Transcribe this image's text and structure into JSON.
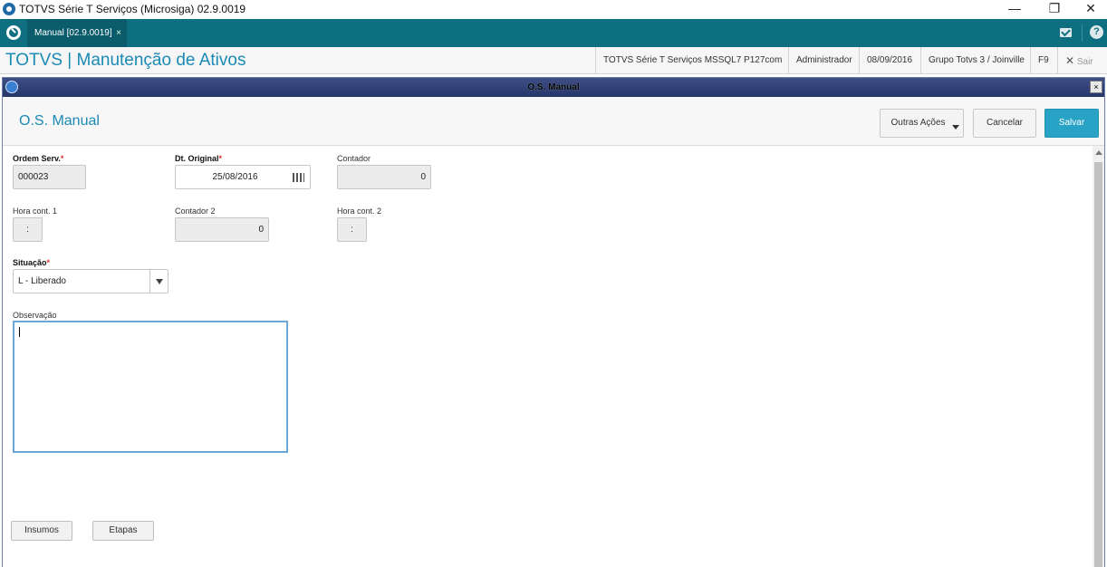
{
  "window": {
    "title": "TOTVS Série T Serviços (Microsiga) 02.9.0019",
    "minimize": "—",
    "restore": "❐",
    "close": "✕"
  },
  "tabbar": {
    "tab_label": "Manual [02.9.0019]",
    "tab_close": "×",
    "help": "?"
  },
  "header": {
    "title": "TOTVS | Manutenção de Ativos",
    "environment": "TOTVS Série T Serviços MSSQL7 P127com",
    "user": "Administrador",
    "date": "08/09/2016",
    "company": "Grupo Totvs 3 / Joinville",
    "shortcut": "F9",
    "exit_icon": "✕",
    "exit_label": "Sair"
  },
  "dialog": {
    "title": "O.S. Manual",
    "close": "×"
  },
  "form": {
    "title": "O.S. Manual",
    "actions": {
      "more": "Outras Ações",
      "cancel": "Cancelar",
      "save": "Salvar"
    },
    "fields": {
      "ordem_label": "Ordem Serv.",
      "ordem_value": "000023",
      "dt_original_label": "Dt. Original",
      "dt_original_value": "25/08/2016",
      "contador_label": "Contador",
      "contador_value": "0",
      "hora1_label": "Hora cont. 1",
      "hora1_value": ":",
      "contador2_label": "Contador 2",
      "contador2_value": "0",
      "hora2_label": "Hora cont. 2",
      "hora2_value": ":",
      "situacao_label": "Situação",
      "situacao_value": "L - Liberado",
      "observacao_label": "Observação",
      "required_mark": "*"
    },
    "bottom_buttons": {
      "insumos": "Insumos",
      "etapas": "Etapas"
    }
  },
  "colors": {
    "tabbar": "#0e6f80",
    "accent": "#1b8ab5",
    "primary_button": "#29a3c5",
    "dialog_title": "#26366a"
  }
}
